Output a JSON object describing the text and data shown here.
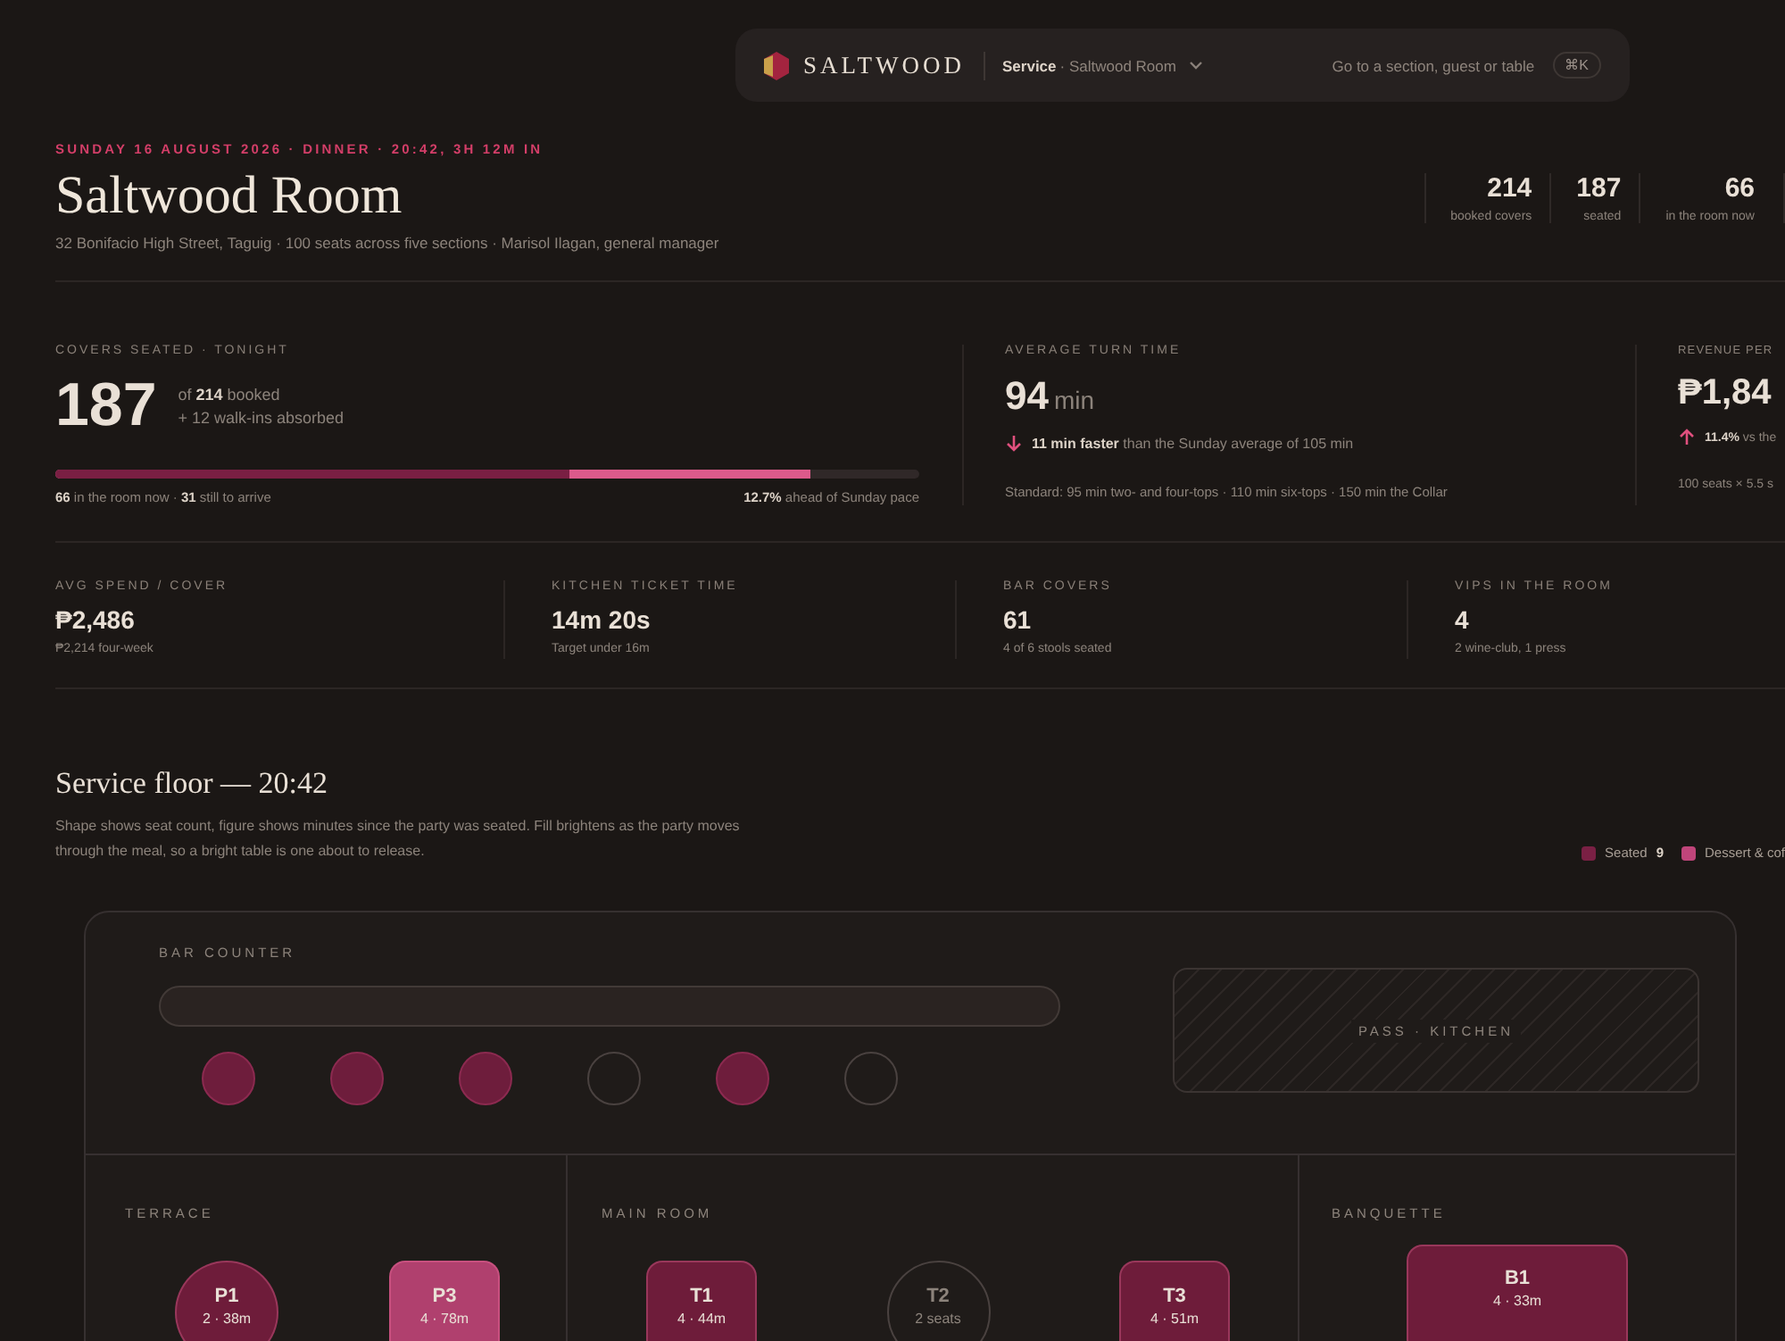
{
  "nav": {
    "brand": "SALTWOOD",
    "mode": "Service",
    "venue": "· Saltwood Room",
    "search_placeholder": "Go to a section, guest or table",
    "shortcut": "⌘K"
  },
  "header": {
    "eyebrow": "SUNDAY 16 AUGUST 2026 · DINNER · 20:42, 3H 12M IN",
    "title": "Saltwood Room",
    "subtitle": "32 Bonifacio High Street, Taguig · 100 seats across five sections · Marisol Ilagan, general manager",
    "stats": [
      {
        "value": "214",
        "label": "booked covers"
      },
      {
        "value": "187",
        "label": "seated"
      },
      {
        "value": "66",
        "label": "in the room now"
      }
    ]
  },
  "kpis": [
    {
      "kind": "progress",
      "label": "COVERS SEATED · TONIGHT",
      "value": "187",
      "note": "of **214** booked",
      "note2": "+ 12 walk-ins absorbed",
      "segments": [
        {
          "kind": "bright",
          "level": 0.874
        },
        {
          "kind": "dark",
          "level": 0.595
        }
      ],
      "foot_left": "**66** in the room now · **31** still to arrive",
      "foot_right": "**12.7%** ahead of Sunday pace"
    },
    {
      "kind": "turn",
      "label": "AVERAGE TURN TIME",
      "value": "94",
      "unit": "min",
      "rising": false,
      "delta": "**11 min faster** than the Sunday average of 105 min",
      "foot": "Standard: 95 min two- and four-tops · 110 min six-tops · 150 min the Collar"
    },
    {
      "kind": "turn",
      "label": "REVENUE PER",
      "value": "₱1,84",
      "rising": true,
      "delta": "**11.4%** vs the",
      "foot": "100 seats × 5.5 s"
    }
  ],
  "small_kpis": [
    {
      "label": "AVG SPEND / COVER",
      "value": "₱2,486",
      "note": "₱2,214 four-week"
    },
    {
      "label": "KITCHEN TICKET TIME",
      "value": "14m 20s",
      "note": "Target under 16m"
    },
    {
      "label": "BAR COVERS",
      "value": "61",
      "note": "4 of 6 stools seated"
    },
    {
      "label": "VIPS IN THE ROOM",
      "value": "4",
      "note": "2 wine-club, 1 press"
    }
  ],
  "floor": {
    "title": "Service floor — 20:42",
    "description": "Shape shows seat count, figure shows minutes since the party was seated. Fill brightens as the party moves through the meal, so a bright table is one about to release.",
    "legend": [
      {
        "label": "Seated",
        "count": "9",
        "color": "#7a2044"
      },
      {
        "label": "Dessert & cof",
        "color": "#c0457a"
      }
    ],
    "bar_label": "BAR COUNTER",
    "stools": [
      {
        "seated": true
      },
      {
        "seated": true
      },
      {
        "seated": true
      },
      {
        "seated": false
      },
      {
        "seated": true
      },
      {
        "seated": false
      }
    ],
    "pass_label": "PASS · KITCHEN",
    "sections": [
      {
        "name": "TERRACE",
        "tables": [
          {
            "kind": "round",
            "occupied": true,
            "color": "#6e1c3a",
            "id": "P1",
            "info": "2 · 38m"
          },
          {
            "kind": "square",
            "occupied": true,
            "color": "#b0406e",
            "id": "P3",
            "info": "4 · 78m"
          }
        ]
      },
      {
        "name": "MAIN ROOM",
        "tables": [
          {
            "kind": "square",
            "occupied": true,
            "color": "#6e1c3a",
            "id": "T1",
            "info": "4 · 44m"
          },
          {
            "kind": "round",
            "occupied": false,
            "id": "T2",
            "info": "2 seats"
          },
          {
            "kind": "square",
            "occupied": true,
            "color": "#6e1c3a",
            "id": "T3",
            "info": "4 · 51m"
          }
        ]
      },
      {
        "name": "BANQUETTE",
        "tables": [
          {
            "kind": "long",
            "occupied": true,
            "color": "#6e1c3a",
            "id": "B1",
            "info": "4 · 33m"
          }
        ]
      }
    ]
  }
}
